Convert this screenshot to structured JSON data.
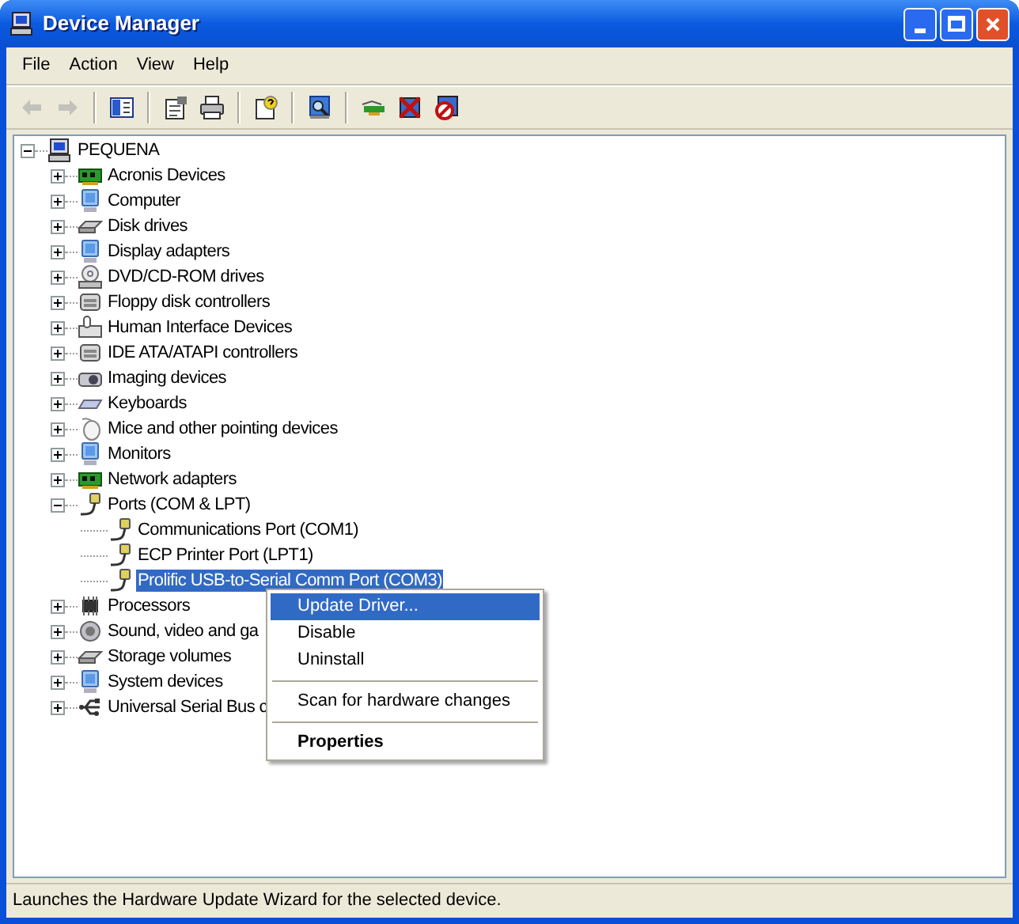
{
  "window": {
    "title": "Device Manager"
  },
  "menu_bar": [
    {
      "label": "File"
    },
    {
      "label": "Action"
    },
    {
      "label": "View"
    },
    {
      "label": "Help"
    }
  ],
  "toolbar": [
    {
      "kind": "back",
      "disabled": true
    },
    {
      "kind": "forward",
      "disabled": true
    },
    {
      "kind": "separator"
    },
    {
      "kind": "tree",
      "disabled": false
    },
    {
      "kind": "separator"
    },
    {
      "kind": "properties",
      "disabled": false
    },
    {
      "kind": "print",
      "disabled": false
    },
    {
      "kind": "separator"
    },
    {
      "kind": "help",
      "disabled": false
    },
    {
      "kind": "separator"
    },
    {
      "kind": "scan",
      "disabled": false
    },
    {
      "kind": "separator"
    },
    {
      "kind": "update",
      "disabled": false
    },
    {
      "kind": "uninstall",
      "disabled": false
    },
    {
      "kind": "disable",
      "disabled": false
    }
  ],
  "tree": {
    "label": "PEQUENA",
    "expanded": true,
    "selected": false,
    "children": [
      {
        "label": "Acronis Devices",
        "expanded": false,
        "selected": false
      },
      {
        "label": "Computer",
        "expanded": false,
        "selected": false
      },
      {
        "label": "Disk drives",
        "expanded": false,
        "selected": false
      },
      {
        "label": "Display adapters",
        "expanded": false,
        "selected": false
      },
      {
        "label": "DVD/CD-ROM drives",
        "expanded": false,
        "selected": false
      },
      {
        "label": "Floppy disk controllers",
        "expanded": false,
        "selected": false
      },
      {
        "label": "Human Interface Devices",
        "expanded": false,
        "selected": false
      },
      {
        "label": "IDE ATA/ATAPI controllers",
        "expanded": false,
        "selected": false
      },
      {
        "label": "Imaging devices",
        "expanded": false,
        "selected": false
      },
      {
        "label": "Keyboards",
        "expanded": false,
        "selected": false
      },
      {
        "label": "Mice and other pointing devices",
        "expanded": false,
        "selected": false
      },
      {
        "label": "Monitors",
        "expanded": false,
        "selected": false
      },
      {
        "label": "Network adapters",
        "expanded": false,
        "selected": false
      },
      {
        "label": "Ports (COM & LPT)",
        "expanded": true,
        "selected": false,
        "children": [
          {
            "label": "Communications Port (COM1)",
            "selected": false
          },
          {
            "label": "ECP Printer Port (LPT1)",
            "selected": false
          },
          {
            "label": "Prolific USB-to-Serial Comm Port (COM3)",
            "selected": true
          }
        ]
      },
      {
        "label": "Processors",
        "expanded": false,
        "selected": false
      },
      {
        "label": "Sound, video and ga",
        "expanded": false,
        "selected": false
      },
      {
        "label": "Storage volumes",
        "expanded": false,
        "selected": false
      },
      {
        "label": "System devices",
        "expanded": false,
        "selected": false
      },
      {
        "label": "Universal Serial Bus c",
        "expanded": false,
        "selected": false
      }
    ]
  },
  "context_menu": [
    {
      "kind": "item",
      "label": "Update Driver...",
      "selected": true,
      "default": false
    },
    {
      "kind": "item",
      "label": "Disable",
      "selected": false,
      "default": false
    },
    {
      "kind": "item",
      "label": "Uninstall",
      "selected": false,
      "default": false
    },
    {
      "kind": "separator"
    },
    {
      "kind": "item",
      "label": "Scan for hardware changes",
      "selected": false,
      "default": false
    },
    {
      "kind": "separator"
    },
    {
      "kind": "item",
      "label": "Properties",
      "selected": false,
      "default": true
    }
  ],
  "status_bar": {
    "text": "Launches the Hardware Update Wizard for the selected device."
  }
}
